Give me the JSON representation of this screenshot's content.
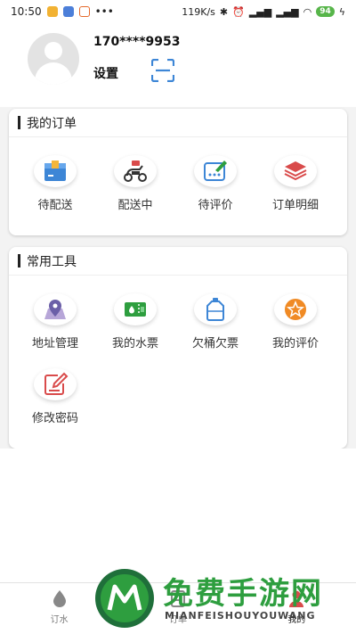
{
  "status_bar": {
    "time": "10:50",
    "network_speed": "119K/s",
    "battery": "94",
    "more": "•••"
  },
  "profile": {
    "phone": "170****9953",
    "settings_label": "设置"
  },
  "orders": {
    "title": "我的订单",
    "items": [
      {
        "label": "待配送",
        "icon": "package-icon"
      },
      {
        "label": "配送中",
        "icon": "scooter-icon"
      },
      {
        "label": "待评价",
        "icon": "review-pen-icon"
      },
      {
        "label": "订单明细",
        "icon": "stack-layers-icon"
      }
    ]
  },
  "tools": {
    "title": "常用工具",
    "items": [
      {
        "label": "地址管理",
        "icon": "map-pin-icon"
      },
      {
        "label": "我的水票",
        "icon": "water-ticket-icon"
      },
      {
        "label": "欠桶欠票",
        "icon": "water-bucket-icon"
      },
      {
        "label": "我的评价",
        "icon": "star-icon"
      },
      {
        "label": "修改密码",
        "icon": "edit-password-icon"
      }
    ]
  },
  "bottom_nav": [
    {
      "label": "订水",
      "icon": "water-drop-icon"
    },
    {
      "label": "订单",
      "icon": "order-icon"
    },
    {
      "label": "我的",
      "icon": "user-icon",
      "active": true
    }
  ],
  "watermark": {
    "title": "免费手游网",
    "subtitle": "MIANFEISHOUYOUWANG"
  },
  "colors": {
    "accent_blue": "#3d86d6",
    "accent_red": "#d94b4b",
    "accent_orange": "#f08a24",
    "accent_green": "#2e9e3f"
  }
}
